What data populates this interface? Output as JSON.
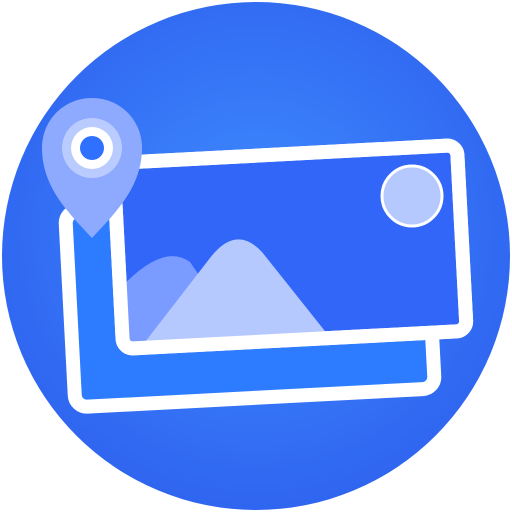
{
  "icon": {
    "name": "photo-location-app-icon",
    "glyphs": [
      "photo-frame-back-icon",
      "photo-frame-front-icon",
      "mountain-icon",
      "sun-icon",
      "location-pin-icon"
    ],
    "colors": {
      "background_center": "#3F8BFF",
      "background_edge": "#2F65F0",
      "frame_border": "#FFFFFF",
      "front_photo_fill": "#3166F8",
      "back_photo_fill": "#2D7CFF",
      "mountain_main": "#B5C9FF",
      "mountain_back": "#7A9BFF",
      "sun": "#B5C9FF",
      "pin_outer": "#8EAAFF",
      "pin_ring": "#B9CBFF",
      "pin_dot": "#2F70FF"
    }
  }
}
